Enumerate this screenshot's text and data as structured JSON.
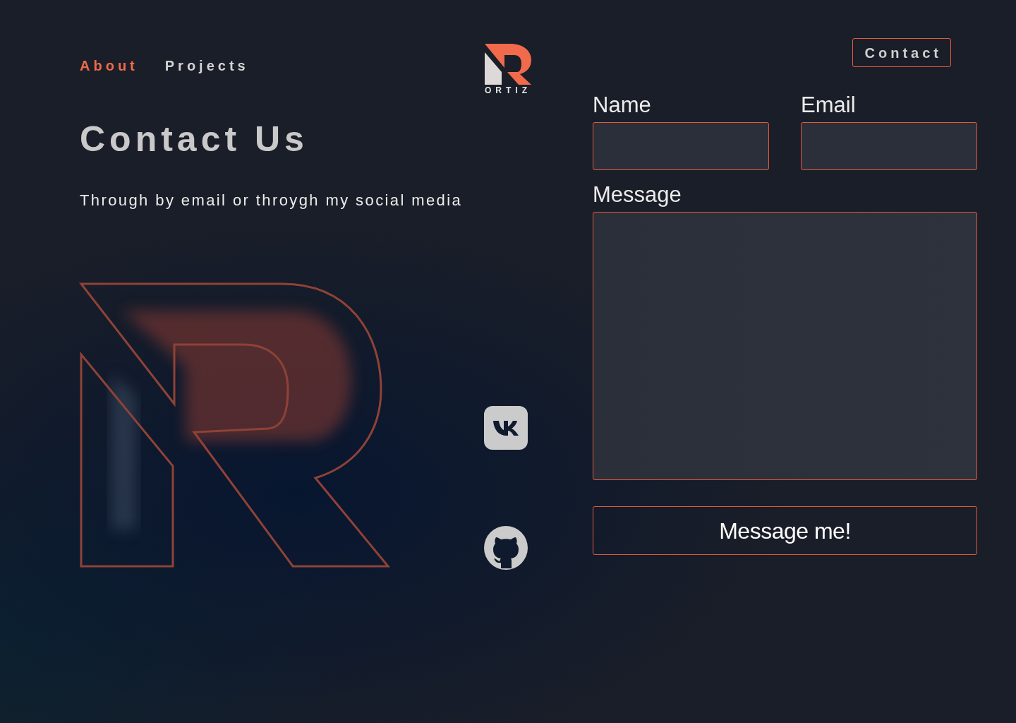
{
  "nav": [
    {
      "label": "About",
      "selected": true
    },
    {
      "label": "Projects",
      "selected": false
    }
  ],
  "logo": {
    "text": "ORTIZ"
  },
  "contact_button": "Contact",
  "heading": "Contact Us",
  "subtitle": "Through by email or throygh my social media",
  "socials": [
    {
      "kind": "vk"
    },
    {
      "kind": "github"
    }
  ],
  "form": {
    "fields": [
      {
        "label": "Name",
        "kind": "input"
      },
      {
        "label": "Email",
        "kind": "input"
      },
      {
        "label": "Message",
        "kind": "textarea"
      }
    ],
    "submit": "Message me!"
  }
}
